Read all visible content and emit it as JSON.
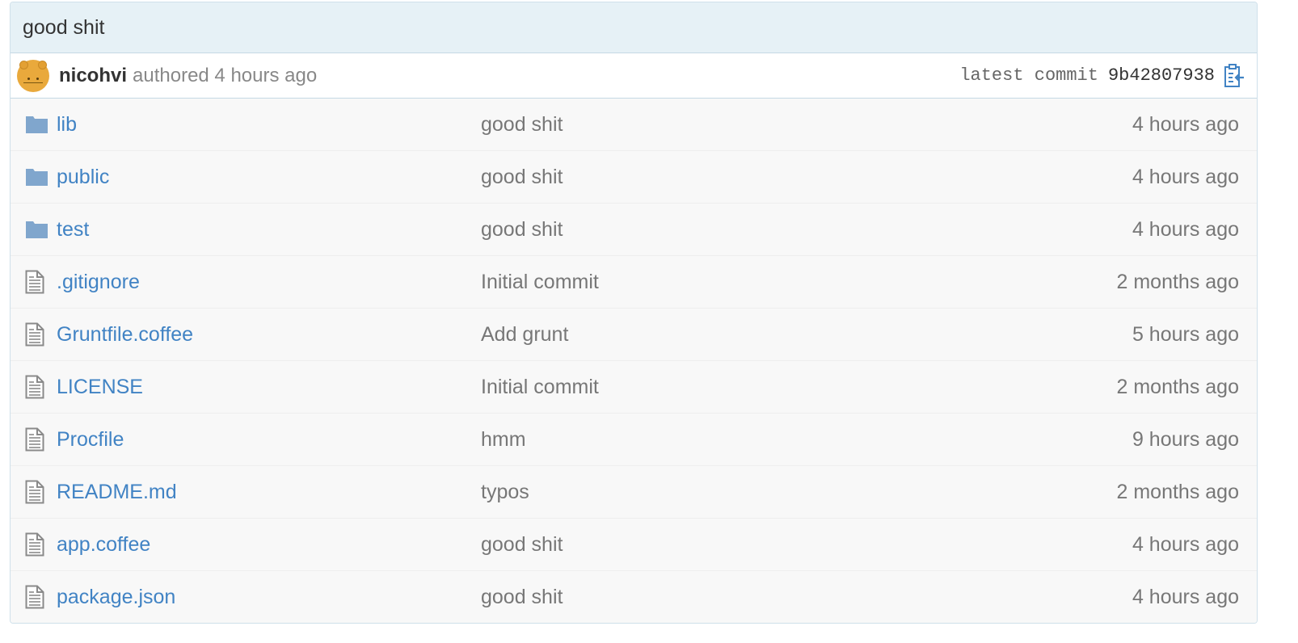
{
  "commit": {
    "title": "good shit",
    "author": "nicohvi",
    "authored_text": "authored 4 hours ago",
    "latest_label": "latest commit",
    "sha": "9b42807938"
  },
  "colors": {
    "link": "#4183c4",
    "header_bg": "#e6f1f6",
    "folder_icon": "#80a6cd",
    "row_bg": "#f8f8f8"
  },
  "files": [
    {
      "type": "folder",
      "icon": "folder-icon",
      "name": "lib",
      "message": "good shit",
      "age": "4 hours ago"
    },
    {
      "type": "folder",
      "icon": "folder-icon",
      "name": "public",
      "message": "good shit",
      "age": "4 hours ago"
    },
    {
      "type": "folder",
      "icon": "folder-icon",
      "name": "test",
      "message": "good shit",
      "age": "4 hours ago"
    },
    {
      "type": "file",
      "icon": "file-icon",
      "name": ".gitignore",
      "message": "Initial commit",
      "age": "2 months ago"
    },
    {
      "type": "file",
      "icon": "file-icon",
      "name": "Gruntfile.coffee",
      "message": "Add grunt",
      "age": "5 hours ago"
    },
    {
      "type": "file",
      "icon": "file-icon",
      "name": "LICENSE",
      "message": "Initial commit",
      "age": "2 months ago"
    },
    {
      "type": "file",
      "icon": "file-icon",
      "name": "Procfile",
      "message": "hmm",
      "age": "9 hours ago"
    },
    {
      "type": "file",
      "icon": "file-icon",
      "name": "README.md",
      "message": "typos",
      "age": "2 months ago"
    },
    {
      "type": "file",
      "icon": "file-icon",
      "name": "app.coffee",
      "message": "good shit",
      "age": "4 hours ago"
    },
    {
      "type": "file",
      "icon": "file-icon",
      "name": "package.json",
      "message": "good shit",
      "age": "4 hours ago"
    }
  ]
}
